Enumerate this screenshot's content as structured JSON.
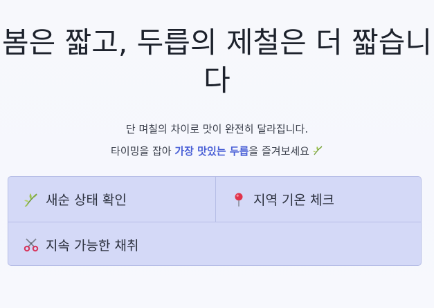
{
  "hero": {
    "title": "봄은 짧고, 두릅의 제철은 더 짧습니다"
  },
  "subtitle": {
    "line1": "단 며칠의 차이로 맛이 완전히 달라집니다.",
    "line2_prefix": "타이밍을 잡아 ",
    "line2_highlight": "가장 맛있는 두릅",
    "line2_suffix": "을 즐겨보세요"
  },
  "features": [
    {
      "icon": "herb-icon",
      "label": "새순 상태 확인"
    },
    {
      "icon": "pushpin-icon",
      "label": "지역 기온 체크"
    },
    {
      "icon": "scissors-icon",
      "label": "지속 가능한 채취"
    }
  ],
  "colors": {
    "highlight": "#4a60d6",
    "panel": "#d4d9f7",
    "panel_border": "#b6bde6"
  }
}
